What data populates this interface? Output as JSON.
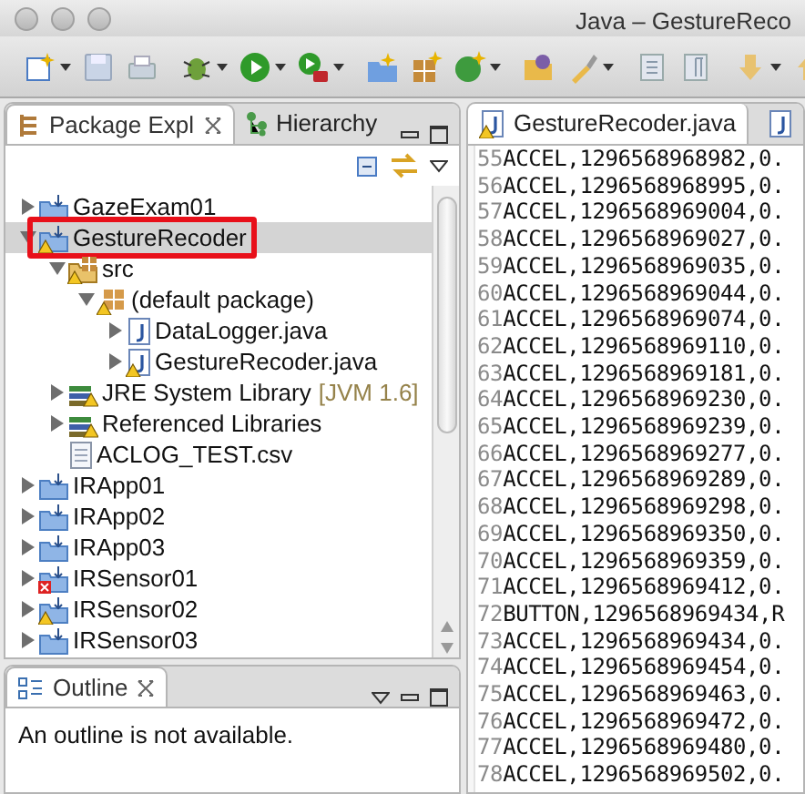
{
  "window": {
    "title": "Java – GestureReco"
  },
  "left_tabs": [
    {
      "label": "Package Expl",
      "selected": true,
      "kind": "packages",
      "closable": true
    },
    {
      "label": "Hierarchy",
      "selected": false,
      "kind": "hierarchy",
      "closable": false
    }
  ],
  "tree": [
    {
      "label": "GazeExam01",
      "kind": "project",
      "expanded": false,
      "selected": false,
      "highlighted": false
    },
    {
      "label": "GestureRecoder",
      "kind": "project-warning",
      "expanded": true,
      "selected": true,
      "highlighted": true,
      "children": [
        {
          "label": "src",
          "kind": "source-folder",
          "expanded": true,
          "selected": false,
          "highlighted": false,
          "children": [
            {
              "label": "(default package)",
              "kind": "package",
              "expanded": true,
              "selected": false,
              "highlighted": false,
              "children": [
                {
                  "label": "DataLogger.java",
                  "kind": "java-file",
                  "expanded": false,
                  "selected": false,
                  "highlighted": false
                },
                {
                  "label": "GestureRecoder.java",
                  "kind": "java-file-warning",
                  "expanded": false,
                  "selected": false,
                  "highlighted": false
                }
              ]
            }
          ]
        },
        {
          "label": "JRE System Library",
          "decoration": "[JVM 1.6]",
          "kind": "library",
          "expanded": false,
          "selected": false,
          "highlighted": false
        },
        {
          "label": "Referenced Libraries",
          "kind": "library",
          "expanded": false,
          "selected": false,
          "highlighted": false
        },
        {
          "label": "ACLOG_TEST.csv",
          "kind": "text-file",
          "selected": false,
          "highlighted": false
        }
      ]
    },
    {
      "label": "IRApp01",
      "kind": "project",
      "expanded": false,
      "selected": false,
      "highlighted": false
    },
    {
      "label": "IRApp02",
      "kind": "project",
      "expanded": false,
      "selected": false,
      "highlighted": false
    },
    {
      "label": "IRApp03",
      "kind": "project",
      "expanded": false,
      "selected": false,
      "highlighted": false
    },
    {
      "label": "IRSensor01",
      "kind": "project-error",
      "expanded": false,
      "selected": false,
      "highlighted": false
    },
    {
      "label": "IRSensor02",
      "kind": "project-warning",
      "expanded": false,
      "selected": false,
      "highlighted": false
    },
    {
      "label": "IRSensor03",
      "kind": "project",
      "expanded": false,
      "selected": false,
      "highlighted": false
    }
  ],
  "outline": {
    "tab": {
      "label": "Outline",
      "selected": true,
      "closable": true
    },
    "message": "An outline is not available."
  },
  "editor_tabs": [
    {
      "label": "GestureRecoder.java",
      "selected": true,
      "warning": true
    },
    {
      "selected": false,
      "warning": false
    }
  ],
  "editor_lines": [
    {
      "number": "55",
      "text": "ACCEL,1296568968982,0."
    },
    {
      "number": "56",
      "text": "ACCEL,1296568968995,0."
    },
    {
      "number": "57",
      "text": "ACCEL,1296568969004,0."
    },
    {
      "number": "58",
      "text": "ACCEL,1296568969027,0."
    },
    {
      "number": "59",
      "text": "ACCEL,1296568969035,0."
    },
    {
      "number": "60",
      "text": "ACCEL,1296568969044,0."
    },
    {
      "number": "61",
      "text": "ACCEL,1296568969074,0."
    },
    {
      "number": "62",
      "text": "ACCEL,1296568969110,0."
    },
    {
      "number": "63",
      "text": "ACCEL,1296568969181,0."
    },
    {
      "number": "64",
      "text": "ACCEL,1296568969230,0."
    },
    {
      "number": "65",
      "text": "ACCEL,1296568969239,0."
    },
    {
      "number": "66",
      "text": "ACCEL,1296568969277,0."
    },
    {
      "number": "67",
      "text": "ACCEL,1296568969289,0."
    },
    {
      "number": "68",
      "text": "ACCEL,1296568969298,0."
    },
    {
      "number": "69",
      "text": "ACCEL,1296568969350,0."
    },
    {
      "number": "70",
      "text": "ACCEL,1296568969359,0."
    },
    {
      "number": "71",
      "text": "ACCEL,1296568969412,0."
    },
    {
      "number": "72",
      "text": "BUTTON,1296568969434,R"
    },
    {
      "number": "73",
      "text": "ACCEL,1296568969434,0."
    },
    {
      "number": "74",
      "text": "ACCEL,1296568969454,0."
    },
    {
      "number": "75",
      "text": "ACCEL,1296568969463,0."
    },
    {
      "number": "76",
      "text": "ACCEL,1296568969472,0."
    },
    {
      "number": "77",
      "text": "ACCEL,1296568969480,0."
    },
    {
      "number": "78",
      "text": "ACCEL,1296568969502,0."
    }
  ]
}
